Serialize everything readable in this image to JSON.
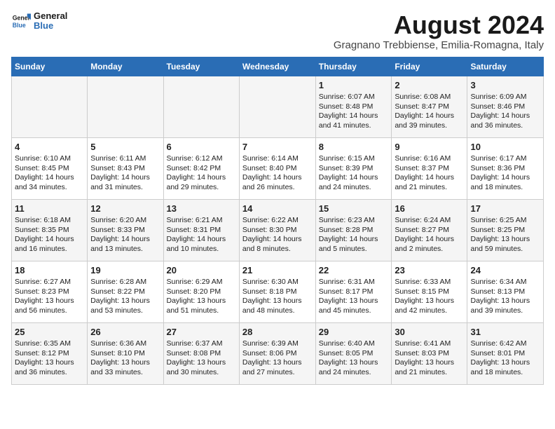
{
  "header": {
    "logo_line1": "General",
    "logo_line2": "Blue",
    "month_year": "August 2024",
    "location": "Gragnano Trebbiense, Emilia-Romagna, Italy"
  },
  "days_of_week": [
    "Sunday",
    "Monday",
    "Tuesday",
    "Wednesday",
    "Thursday",
    "Friday",
    "Saturday"
  ],
  "weeks": [
    [
      {
        "day": "",
        "info": ""
      },
      {
        "day": "",
        "info": ""
      },
      {
        "day": "",
        "info": ""
      },
      {
        "day": "",
        "info": ""
      },
      {
        "day": "1",
        "info": "Sunrise: 6:07 AM\nSunset: 8:48 PM\nDaylight: 14 hours\nand 41 minutes."
      },
      {
        "day": "2",
        "info": "Sunrise: 6:08 AM\nSunset: 8:47 PM\nDaylight: 14 hours\nand 39 minutes."
      },
      {
        "day": "3",
        "info": "Sunrise: 6:09 AM\nSunset: 8:46 PM\nDaylight: 14 hours\nand 36 minutes."
      }
    ],
    [
      {
        "day": "4",
        "info": "Sunrise: 6:10 AM\nSunset: 8:45 PM\nDaylight: 14 hours\nand 34 minutes."
      },
      {
        "day": "5",
        "info": "Sunrise: 6:11 AM\nSunset: 8:43 PM\nDaylight: 14 hours\nand 31 minutes."
      },
      {
        "day": "6",
        "info": "Sunrise: 6:12 AM\nSunset: 8:42 PM\nDaylight: 14 hours\nand 29 minutes."
      },
      {
        "day": "7",
        "info": "Sunrise: 6:14 AM\nSunset: 8:40 PM\nDaylight: 14 hours\nand 26 minutes."
      },
      {
        "day": "8",
        "info": "Sunrise: 6:15 AM\nSunset: 8:39 PM\nDaylight: 14 hours\nand 24 minutes."
      },
      {
        "day": "9",
        "info": "Sunrise: 6:16 AM\nSunset: 8:37 PM\nDaylight: 14 hours\nand 21 minutes."
      },
      {
        "day": "10",
        "info": "Sunrise: 6:17 AM\nSunset: 8:36 PM\nDaylight: 14 hours\nand 18 minutes."
      }
    ],
    [
      {
        "day": "11",
        "info": "Sunrise: 6:18 AM\nSunset: 8:35 PM\nDaylight: 14 hours\nand 16 minutes."
      },
      {
        "day": "12",
        "info": "Sunrise: 6:20 AM\nSunset: 8:33 PM\nDaylight: 14 hours\nand 13 minutes."
      },
      {
        "day": "13",
        "info": "Sunrise: 6:21 AM\nSunset: 8:31 PM\nDaylight: 14 hours\nand 10 minutes."
      },
      {
        "day": "14",
        "info": "Sunrise: 6:22 AM\nSunset: 8:30 PM\nDaylight: 14 hours\nand 8 minutes."
      },
      {
        "day": "15",
        "info": "Sunrise: 6:23 AM\nSunset: 8:28 PM\nDaylight: 14 hours\nand 5 minutes."
      },
      {
        "day": "16",
        "info": "Sunrise: 6:24 AM\nSunset: 8:27 PM\nDaylight: 14 hours\nand 2 minutes."
      },
      {
        "day": "17",
        "info": "Sunrise: 6:25 AM\nSunset: 8:25 PM\nDaylight: 13 hours\nand 59 minutes."
      }
    ],
    [
      {
        "day": "18",
        "info": "Sunrise: 6:27 AM\nSunset: 8:23 PM\nDaylight: 13 hours\nand 56 minutes."
      },
      {
        "day": "19",
        "info": "Sunrise: 6:28 AM\nSunset: 8:22 PM\nDaylight: 13 hours\nand 53 minutes."
      },
      {
        "day": "20",
        "info": "Sunrise: 6:29 AM\nSunset: 8:20 PM\nDaylight: 13 hours\nand 51 minutes."
      },
      {
        "day": "21",
        "info": "Sunrise: 6:30 AM\nSunset: 8:18 PM\nDaylight: 13 hours\nand 48 minutes."
      },
      {
        "day": "22",
        "info": "Sunrise: 6:31 AM\nSunset: 8:17 PM\nDaylight: 13 hours\nand 45 minutes."
      },
      {
        "day": "23",
        "info": "Sunrise: 6:33 AM\nSunset: 8:15 PM\nDaylight: 13 hours\nand 42 minutes."
      },
      {
        "day": "24",
        "info": "Sunrise: 6:34 AM\nSunset: 8:13 PM\nDaylight: 13 hours\nand 39 minutes."
      }
    ],
    [
      {
        "day": "25",
        "info": "Sunrise: 6:35 AM\nSunset: 8:12 PM\nDaylight: 13 hours\nand 36 minutes."
      },
      {
        "day": "26",
        "info": "Sunrise: 6:36 AM\nSunset: 8:10 PM\nDaylight: 13 hours\nand 33 minutes."
      },
      {
        "day": "27",
        "info": "Sunrise: 6:37 AM\nSunset: 8:08 PM\nDaylight: 13 hours\nand 30 minutes."
      },
      {
        "day": "28",
        "info": "Sunrise: 6:39 AM\nSunset: 8:06 PM\nDaylight: 13 hours\nand 27 minutes."
      },
      {
        "day": "29",
        "info": "Sunrise: 6:40 AM\nSunset: 8:05 PM\nDaylight: 13 hours\nand 24 minutes."
      },
      {
        "day": "30",
        "info": "Sunrise: 6:41 AM\nSunset: 8:03 PM\nDaylight: 13 hours\nand 21 minutes."
      },
      {
        "day": "31",
        "info": "Sunrise: 6:42 AM\nSunset: 8:01 PM\nDaylight: 13 hours\nand 18 minutes."
      }
    ]
  ]
}
